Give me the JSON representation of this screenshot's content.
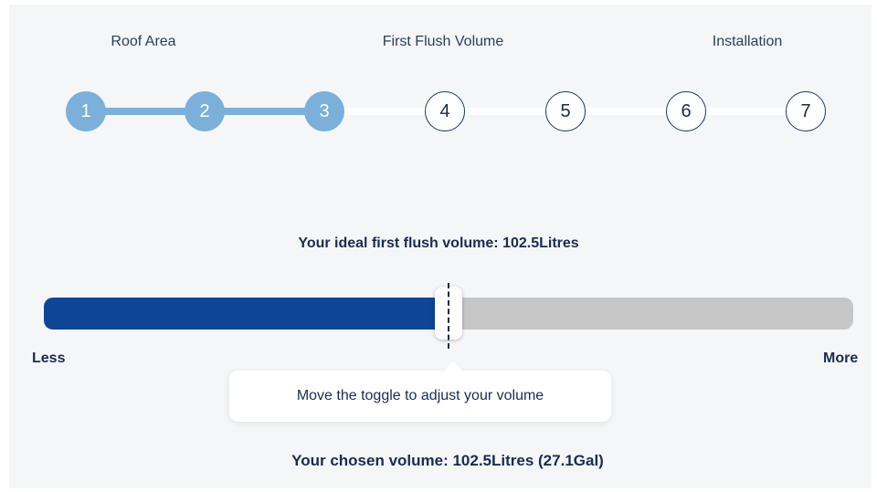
{
  "stepper": {
    "labels": [
      "Roof Area",
      "First Flush Volume",
      "Installation"
    ],
    "steps": [
      {
        "number": "1",
        "state": "completed"
      },
      {
        "number": "2",
        "state": "completed"
      },
      {
        "number": "3",
        "state": "completed"
      },
      {
        "number": "4",
        "state": "pending"
      },
      {
        "number": "5",
        "state": "pending"
      },
      {
        "number": "6",
        "state": "pending"
      },
      {
        "number": "7",
        "state": "pending"
      }
    ]
  },
  "volume": {
    "ideal_text": "Your ideal first flush volume: 102.5Litres",
    "slider_fraction": 0.5,
    "min_label": "Less",
    "max_label": "More",
    "tooltip": "Move the toggle to adjust your volume",
    "chosen_text": "Your chosen volume: 102.5Litres (27.1Gal)"
  },
  "colors": {
    "step_completed": "#7bb0da",
    "slider_fill": "#0f4597",
    "slider_track": "#c6c6c6",
    "text": "#1c2b52"
  }
}
